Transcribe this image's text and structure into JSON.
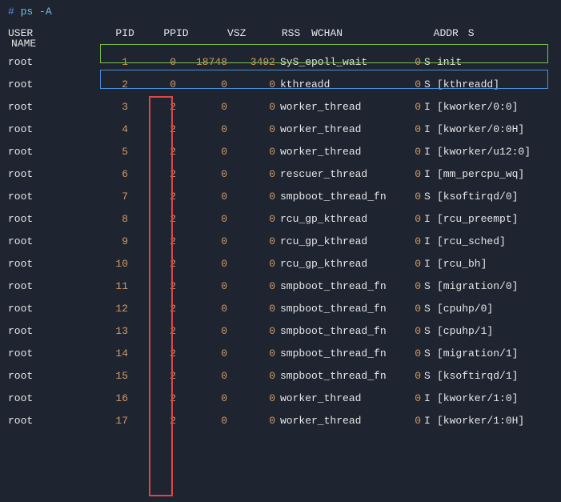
{
  "prompt": {
    "hash": "#",
    "cmd": "ps -A"
  },
  "headers": {
    "user": "USER",
    "pid": "PID",
    "ppid": "PPID",
    "vsz": "VSZ",
    "rss": "RSS",
    "wchan": "WCHAN",
    "addr": "ADDR",
    "s": "S",
    "name": "NAME"
  },
  "rows": [
    {
      "user": "root",
      "pid": "1",
      "ppid": "0",
      "vsz": "18748",
      "rss": "3492",
      "wchan": "SyS_epoll_wait",
      "addr": "0",
      "s": "S",
      "name": "init"
    },
    {
      "user": "root",
      "pid": "2",
      "ppid": "0",
      "vsz": "0",
      "rss": "0",
      "wchan": "kthreadd",
      "addr": "0",
      "s": "S",
      "name": "[kthreadd]"
    },
    {
      "user": "root",
      "pid": "3",
      "ppid": "2",
      "vsz": "0",
      "rss": "0",
      "wchan": "worker_thread",
      "addr": "0",
      "s": "I",
      "name": "[kworker/0:0]"
    },
    {
      "user": "root",
      "pid": "4",
      "ppid": "2",
      "vsz": "0",
      "rss": "0",
      "wchan": "worker_thread",
      "addr": "0",
      "s": "I",
      "name": "[kworker/0:0H]"
    },
    {
      "user": "root",
      "pid": "5",
      "ppid": "2",
      "vsz": "0",
      "rss": "0",
      "wchan": "worker_thread",
      "addr": "0",
      "s": "I",
      "name": "[kworker/u12:0]"
    },
    {
      "user": "root",
      "pid": "6",
      "ppid": "2",
      "vsz": "0",
      "rss": "0",
      "wchan": "rescuer_thread",
      "addr": "0",
      "s": "I",
      "name": "[mm_percpu_wq]"
    },
    {
      "user": "root",
      "pid": "7",
      "ppid": "2",
      "vsz": "0",
      "rss": "0",
      "wchan": "smpboot_thread_fn",
      "addr": "0",
      "s": "S",
      "name": "[ksoftirqd/0]"
    },
    {
      "user": "root",
      "pid": "8",
      "ppid": "2",
      "vsz": "0",
      "rss": "0",
      "wchan": "rcu_gp_kthread",
      "addr": "0",
      "s": "I",
      "name": "[rcu_preempt]"
    },
    {
      "user": "root",
      "pid": "9",
      "ppid": "2",
      "vsz": "0",
      "rss": "0",
      "wchan": "rcu_gp_kthread",
      "addr": "0",
      "s": "I",
      "name": "[rcu_sched]"
    },
    {
      "user": "root",
      "pid": "10",
      "ppid": "2",
      "vsz": "0",
      "rss": "0",
      "wchan": "rcu_gp_kthread",
      "addr": "0",
      "s": "I",
      "name": "[rcu_bh]"
    },
    {
      "user": "root",
      "pid": "11",
      "ppid": "2",
      "vsz": "0",
      "rss": "0",
      "wchan": "smpboot_thread_fn",
      "addr": "0",
      "s": "S",
      "name": "[migration/0]"
    },
    {
      "user": "root",
      "pid": "12",
      "ppid": "2",
      "vsz": "0",
      "rss": "0",
      "wchan": "smpboot_thread_fn",
      "addr": "0",
      "s": "S",
      "name": "[cpuhp/0]"
    },
    {
      "user": "root",
      "pid": "13",
      "ppid": "2",
      "vsz": "0",
      "rss": "0",
      "wchan": "smpboot_thread_fn",
      "addr": "0",
      "s": "S",
      "name": "[cpuhp/1]"
    },
    {
      "user": "root",
      "pid": "14",
      "ppid": "2",
      "vsz": "0",
      "rss": "0",
      "wchan": "smpboot_thread_fn",
      "addr": "0",
      "s": "S",
      "name": "[migration/1]"
    },
    {
      "user": "root",
      "pid": "15",
      "ppid": "2",
      "vsz": "0",
      "rss": "0",
      "wchan": "smpboot_thread_fn",
      "addr": "0",
      "s": "S",
      "name": "[ksoftirqd/1]"
    },
    {
      "user": "root",
      "pid": "16",
      "ppid": "2",
      "vsz": "0",
      "rss": "0",
      "wchan": "worker_thread",
      "addr": "0",
      "s": "I",
      "name": "[kworker/1:0]"
    },
    {
      "user": "root",
      "pid": "17",
      "ppid": "2",
      "vsz": "0",
      "rss": "0",
      "wchan": "worker_thread",
      "addr": "0",
      "s": "I",
      "name": "[kworker/1:0H]"
    }
  ]
}
